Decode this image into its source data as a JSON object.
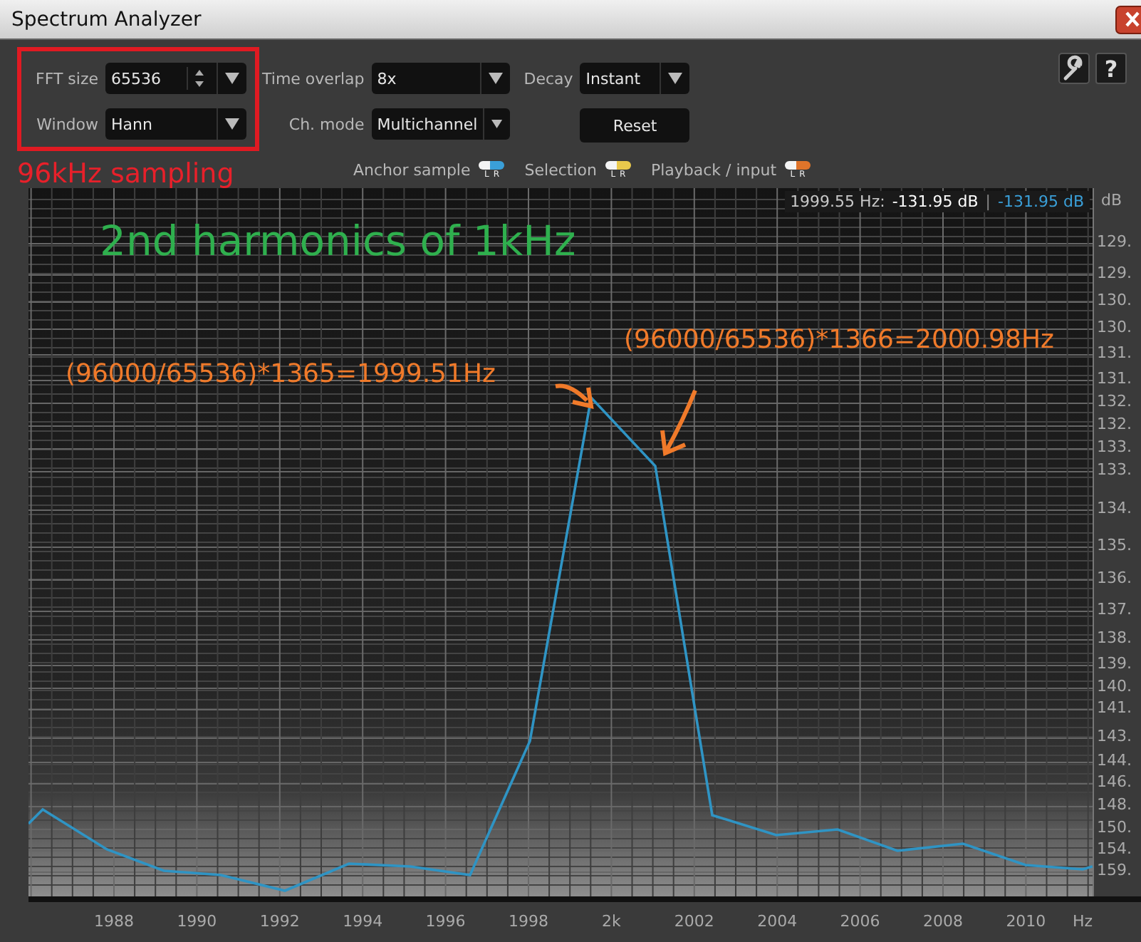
{
  "window": {
    "title": "Spectrum Analyzer"
  },
  "highlighted_controls": [
    {
      "kind": "spinner",
      "label": "FFT size",
      "value": "65536"
    },
    {
      "kind": "dropdown",
      "label": "Window",
      "value": "Hann"
    }
  ],
  "highlight_note": "96kHz sampling",
  "control_columns": [
    {
      "items": [
        {
          "kind": "dropdown",
          "label": "Time overlap",
          "value": "8x"
        },
        {
          "kind": "dropdown",
          "label": "Ch. mode",
          "value": "Multichannel"
        }
      ]
    },
    {
      "items": [
        {
          "kind": "dropdown",
          "label": "Decay",
          "value": "Instant"
        },
        {
          "kind": "button",
          "label": "Reset"
        }
      ]
    }
  ],
  "help_button": "?",
  "legend": [
    {
      "label": "Anchor sample",
      "color": "#3a9fd8",
      "channels": [
        "L",
        "R"
      ]
    },
    {
      "label": "Selection",
      "color": "#e9c94c",
      "channels": [
        "L",
        "R"
      ]
    },
    {
      "label": "Playback / input",
      "color": "#e0742a",
      "channels": [
        "L",
        "R"
      ]
    }
  ],
  "plot": {
    "readout": {
      "frequency": "1999.55 Hz:",
      "left_value": "-131.95 dB",
      "separator": "|",
      "right_value": "-131.95 dB"
    },
    "y_unit": "dB",
    "y_ticks": [
      "129.",
      "129.",
      "130.",
      "130.",
      "131.",
      "131.",
      "132.",
      "132.",
      "133.",
      "133.",
      "134.",
      "135.",
      "136.",
      "137.",
      "138.",
      "139.",
      "140.",
      "141.",
      "143.",
      "144.",
      "146.",
      "148.",
      "150.",
      "154.",
      "159."
    ],
    "x_ticks": [
      "1988",
      "1990",
      "1992",
      "1994",
      "1996",
      "1998",
      "2k",
      "2002",
      "2004",
      "2006",
      "2008",
      "2010"
    ],
    "x_unit": "Hz"
  },
  "annotations": {
    "title": "2nd harmonics of 1kHz",
    "notes": [
      "(96000/65536)*1365=1999.51Hz",
      "(96000/65536)*1366=2000.98Hz"
    ]
  }
}
